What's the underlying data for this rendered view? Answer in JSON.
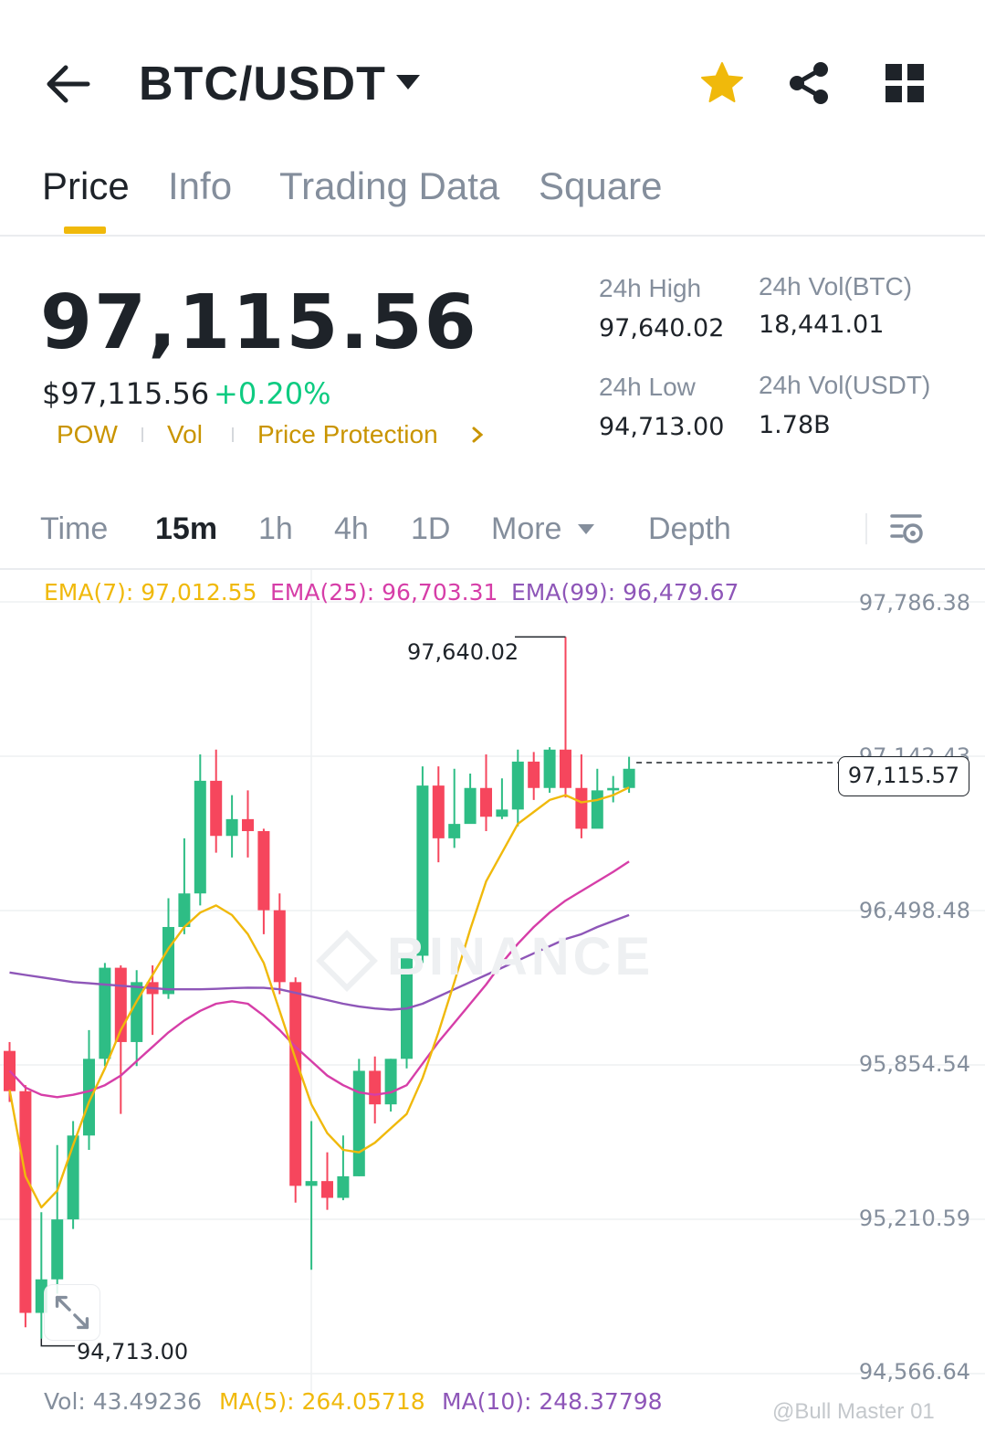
{
  "header": {
    "pair": "BTC/USDT",
    "icons": [
      "back-arrow-icon",
      "caret-down-icon",
      "star-icon",
      "share-icon",
      "grid-icon"
    ],
    "star_color": "#f0b90b"
  },
  "tabs": [
    {
      "label": "Price",
      "active": true
    },
    {
      "label": "Info",
      "active": false
    },
    {
      "label": "Trading Data",
      "active": false
    },
    {
      "label": "Square",
      "active": false
    }
  ],
  "price": {
    "last": "97,115.56",
    "usd": "$97,115.56",
    "change_pct": "+0.20%",
    "tags": [
      "POW",
      "Vol",
      "Price Protection"
    ]
  },
  "stats": {
    "high_label": "24h High",
    "high_value": "97,640.02",
    "low_label": "24h Low",
    "low_value": "94,713.00",
    "vol_btc_label": "24h Vol(BTC)",
    "vol_btc_value": "18,441.01",
    "vol_usdt_label": "24h Vol(USDT)",
    "vol_usdt_value": "1.78B"
  },
  "intervals": {
    "items": [
      "Time",
      "15m",
      "1h",
      "4h",
      "1D",
      "More",
      "Depth"
    ],
    "active": "15m"
  },
  "ema": {
    "ema7": "EMA(7): 97,012.55",
    "ema25": "EMA(25): 96,703.31",
    "ema99": "EMA(99): 96,479.67",
    "ema7_color": "#f0b90b",
    "ema25_color": "#d63ea8",
    "ema99_color": "#8e56b8"
  },
  "chart_data": {
    "type": "candlestick",
    "y_ticks": [
      "97,786.38",
      "97,142.43",
      "96,498.48",
      "95,854.54",
      "95,210.59",
      "94,566.64"
    ],
    "ylim": [
      94566.64,
      97786.38
    ],
    "current_price": "97,115.57",
    "high_marker": "97,640.02",
    "low_marker": "94,713.00",
    "up_color": "#2ebd85",
    "down_color": "#f6465d",
    "candles": [
      [
        95913,
        95745,
        95950,
        95700
      ],
      [
        95745,
        94820,
        95770,
        94760
      ],
      [
        94820,
        94960,
        95240,
        94713
      ],
      [
        94960,
        95210,
        95520,
        94900
      ],
      [
        95210,
        95560,
        95620,
        95170
      ],
      [
        95560,
        95880,
        96000,
        95500
      ],
      [
        95880,
        96260,
        96280,
        95850
      ],
      [
        96260,
        95950,
        96270,
        95650
      ],
      [
        95950,
        96200,
        96250,
        95850
      ],
      [
        96200,
        96150,
        96270,
        95980
      ],
      [
        96150,
        96430,
        96550,
        96130
      ],
      [
        96430,
        96570,
        96800,
        96400
      ],
      [
        96570,
        97040,
        97150,
        96520
      ],
      [
        97040,
        96810,
        97170,
        96740
      ],
      [
        96810,
        96880,
        96980,
        96720
      ],
      [
        96880,
        96830,
        97000,
        96720
      ],
      [
        96830,
        96500,
        96840,
        96400
      ],
      [
        96500,
        96200,
        96570,
        96150
      ],
      [
        96200,
        95350,
        96220,
        95280
      ],
      [
        95350,
        95370,
        95620,
        95000
      ],
      [
        95370,
        95300,
        95490,
        95250
      ],
      [
        95300,
        95390,
        95560,
        95290
      ],
      [
        95390,
        95830,
        95880,
        95390
      ],
      [
        95830,
        95690,
        95890,
        95610
      ],
      [
        95690,
        95880,
        95880,
        95660
      ],
      [
        95880,
        96310,
        96320,
        95840
      ],
      [
        96310,
        97020,
        97100,
        96280
      ],
      [
        97020,
        96800,
        97100,
        96700
      ],
      [
        96800,
        96860,
        97090,
        96760
      ],
      [
        96860,
        97010,
        97070,
        96890
      ],
      [
        97010,
        96890,
        97150,
        96830
      ],
      [
        96890,
        96920,
        97050,
        96880
      ],
      [
        96920,
        97120,
        97170,
        96850
      ],
      [
        97120,
        97010,
        97160,
        96960
      ],
      [
        97010,
        97170,
        97180,
        96990
      ],
      [
        97170,
        97010,
        97640,
        96970
      ],
      [
        97010,
        96840,
        97150,
        96800
      ],
      [
        96840,
        97000,
        97090,
        96870
      ],
      [
        97000,
        97010,
        97060,
        96950
      ],
      [
        97010,
        97090,
        97140,
        96990
      ]
    ],
    "ema7": [
      95750,
      95390,
      95260,
      95330,
      95520,
      95700,
      95840,
      96000,
      96120,
      96230,
      96340,
      96430,
      96490,
      96520,
      96480,
      96400,
      96280,
      96080,
      95880,
      95690,
      95570,
      95500,
      95490,
      95530,
      95590,
      95650,
      95800,
      95990,
      96200,
      96420,
      96620,
      96740,
      96860,
      96910,
      96960,
      96980,
      96950,
      96960,
      96980,
      97012
    ],
    "ema25": [
      95830,
      95760,
      95730,
      95720,
      95730,
      95745,
      95770,
      95810,
      95870,
      95930,
      95990,
      96040,
      96080,
      96110,
      96120,
      96110,
      96060,
      96000,
      95930,
      95870,
      95810,
      95770,
      95740,
      95730,
      95740,
      95770,
      95860,
      95950,
      96030,
      96110,
      96190,
      96280,
      96360,
      96430,
      96490,
      96540,
      96580,
      96620,
      96660,
      96703
    ],
    "ema99": [
      96240,
      96230,
      96220,
      96210,
      96200,
      96195,
      96190,
      96185,
      96180,
      96175,
      96170,
      96170,
      96170,
      96172,
      96175,
      96177,
      96176,
      96170,
      96155,
      96140,
      96125,
      96110,
      96098,
      96090,
      96085,
      96090,
      96110,
      96140,
      96170,
      96200,
      96230,
      96260,
      96290,
      96320,
      96350,
      96380,
      96400,
      96430,
      96455,
      96480
    ]
  },
  "volume": {
    "vol": "Vol: 43.49236",
    "ma5": "MA(5): 264.05718",
    "ma10": "MA(10): 248.37798",
    "vol_color": "#848e9c",
    "ma5_color": "#f0b90b",
    "ma10_color": "#8e56b8"
  },
  "credit": "@Bull Master 01",
  "watermark": "BINANCE"
}
